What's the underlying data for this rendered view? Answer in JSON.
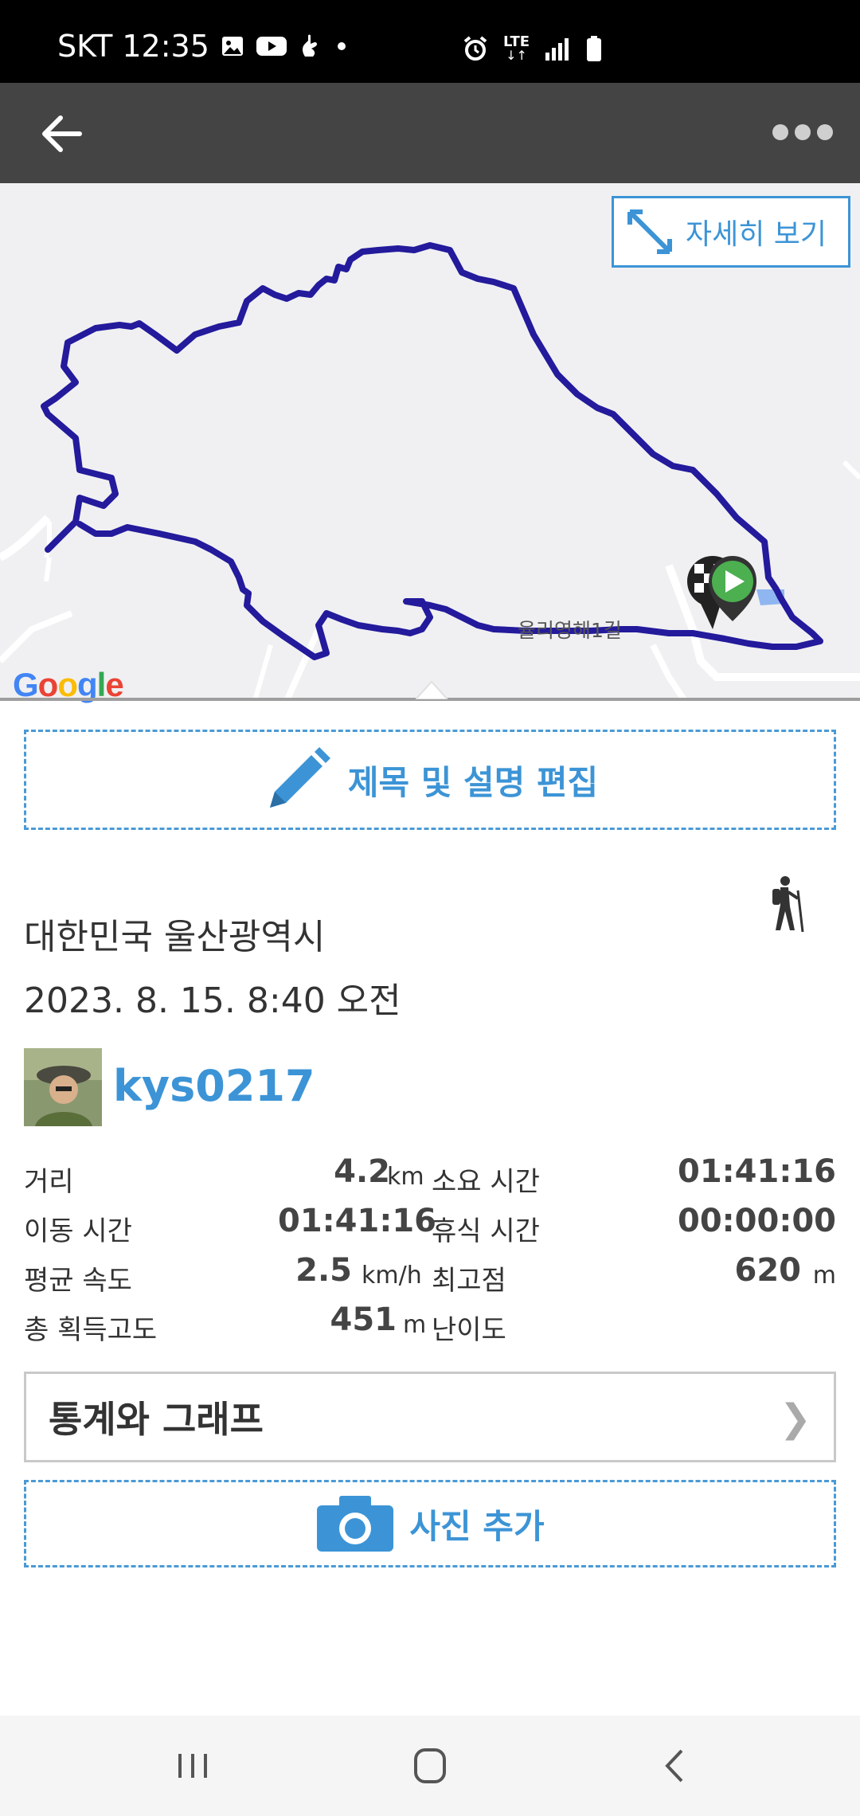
{
  "status_bar": {
    "carrier_time": "SKT 12:35",
    "left_icons": [
      "gallery-icon",
      "youtube-icon",
      "hand-icon",
      "dot-icon"
    ],
    "right_icons": [
      "alarm-icon",
      "lte-icon",
      "signal-icon",
      "battery-icon"
    ],
    "lte_label": "LTE"
  },
  "app_bar": {
    "back_icon": "arrow-left-icon",
    "more_icon": "more-dots-icon"
  },
  "map": {
    "detail_button_label": "자세히 보기",
    "road_label": "율리영해1길",
    "google_logo": "Google",
    "route_color": "#231a9c"
  },
  "edit_button_label": "제목 및 설명 편집",
  "activity": {
    "location": "대한민국 울산광역시",
    "datetime": "2023. 8. 15. 8:40 오전",
    "activity_icon": "hiking-icon"
  },
  "user": {
    "username": "kys0217"
  },
  "stats": {
    "rows": [
      {
        "label_a": "거리",
        "value_a": "4.2",
        "unit_a": "km",
        "label_b": "소요 시간",
        "value_b": "01:41:16",
        "unit_b": ""
      },
      {
        "label_a": "이동 시간",
        "value_a": "01:41:16",
        "unit_a": "",
        "label_b": "휴식 시간",
        "value_b": "00:00:00",
        "unit_b": ""
      },
      {
        "label_a": "평균 속도",
        "value_a": "2.5",
        "unit_a": "km/h",
        "label_b": "최고점",
        "value_b": "620",
        "unit_b": "m"
      },
      {
        "label_a": "총 획득고도",
        "value_a": "451",
        "unit_a": "m",
        "label_b": "난이도",
        "value_b": "",
        "unit_b": ""
      }
    ]
  },
  "stats_graph_label": "통계와 그래프",
  "photo_button_label": "사진 추가",
  "nav_bar": {
    "icons": [
      "recent-apps-icon",
      "home-icon",
      "back-icon"
    ]
  },
  "colors": {
    "accent": "#3c94d6",
    "app_bar": "#444444",
    "route": "#231a9c"
  }
}
